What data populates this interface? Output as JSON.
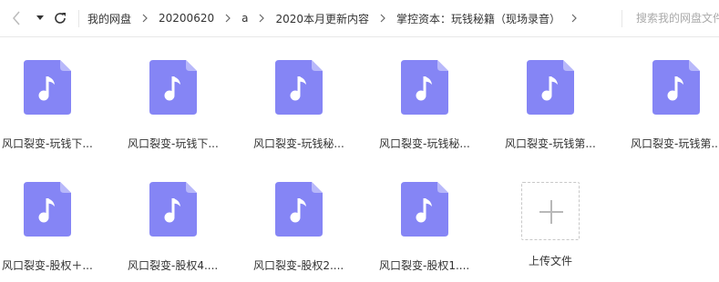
{
  "breadcrumb": [
    "我的网盘",
    "20200620",
    "a",
    "2020本月更新内容",
    "掌控资本：玩钱秘籍（现场录音）"
  ],
  "search": {
    "placeholder": "搜索我的网盘文件"
  },
  "files": [
    {
      "name": "风口裂变-玩钱下..."
    },
    {
      "name": "风口裂变-玩钱下..."
    },
    {
      "name": "风口裂变-玩钱秘..."
    },
    {
      "name": "风口裂变-玩钱秘..."
    },
    {
      "name": "风口裂变-玩钱第..."
    },
    {
      "name": "风口裂变-玩钱第..."
    },
    {
      "name": "风口裂变-股权＋..."
    },
    {
      "name": "风口裂变-股权4...."
    },
    {
      "name": "风口裂变-股权2...."
    },
    {
      "name": "风口裂变-股权1...."
    }
  ],
  "upload": {
    "label": "上传文件"
  },
  "colors": {
    "icon_body": "#8585f5",
    "icon_fold": "#b8b8fa",
    "border": "#e8e8e8"
  },
  "icons": {
    "file": "audio-file-icon",
    "back": "chevron-left-icon",
    "forward": "caret-down-icon",
    "refresh": "refresh-icon",
    "upload": "plus-icon"
  }
}
